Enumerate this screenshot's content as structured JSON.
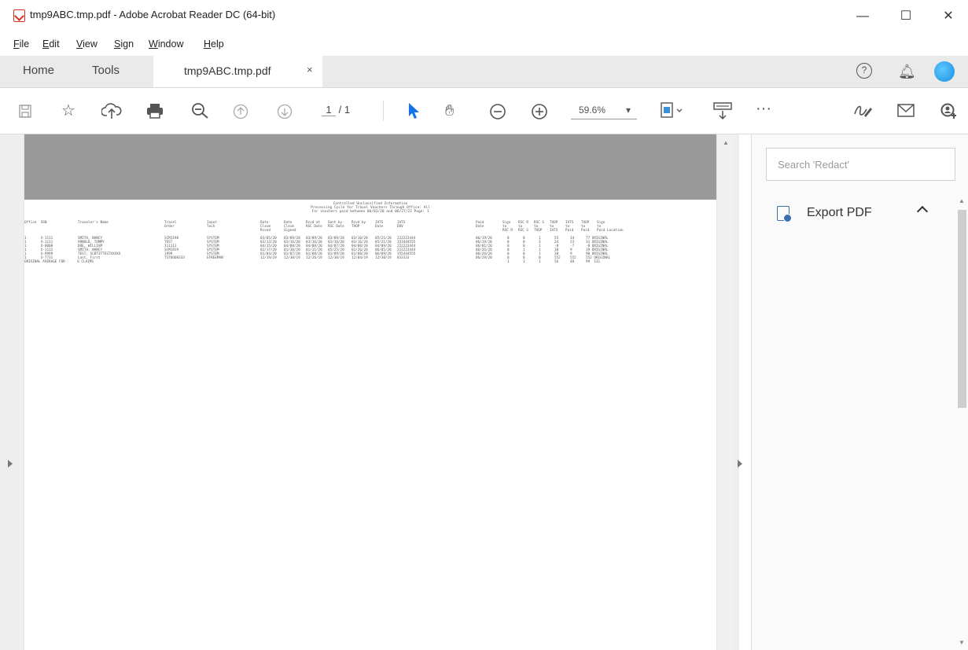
{
  "window": {
    "title": "tmp9ABC.tmp.pdf - Adobe Acrobat Reader DC (64-bit)",
    "minimize": "—",
    "maximize": "☐",
    "close": "✕"
  },
  "menu": [
    {
      "underline": "F",
      "rest": "ile"
    },
    {
      "underline": "E",
      "rest": "dit"
    },
    {
      "underline": "V",
      "rest": "iew"
    },
    {
      "underline": "S",
      "rest": "ign"
    },
    {
      "underline": "W",
      "rest": "indow"
    },
    {
      "underline": "H",
      "rest": "elp"
    }
  ],
  "tabs": {
    "home": "Home",
    "tools": "Tools",
    "document": "tmp9ABC.tmp.pdf",
    "close": "×",
    "help": "?"
  },
  "toolbar": {
    "page_current": "1",
    "page_total": "/ 1",
    "zoom": "59.6%",
    "zoom_caret": "▾",
    "more": "···"
  },
  "icons": {
    "save": "save-icon",
    "bookmark": "star-icon",
    "upload": "cloud-upload-icon",
    "print": "printer-icon",
    "search": "magnifier-icon",
    "prev": "page-up-icon",
    "next": "page-down-icon",
    "select": "cursor-icon",
    "hand": "hand-icon",
    "zoom_out": "zoom-out-icon",
    "zoom_in": "zoom-in-icon",
    "fit": "fit-page-icon",
    "stamp": "stamp-icon",
    "sign": "sign-icon",
    "mail": "mail-icon",
    "account": "account-icon"
  },
  "right_pane": {
    "search_placeholder": "Search 'Redact'",
    "export_label": "Export PDF"
  },
  "colors": {
    "accent": "#1473e6",
    "avatar": "#1a8fe0",
    "banner": "#999999"
  },
  "report": {
    "header_lines": [
      "Controlled Unclassified Information",
      "Processing Cycle for Travel Vouchers Through Office: All",
      "For vouchers paid between 06/01/20 and 06/27/22       Page:  1"
    ],
    "columns": [
      "Office  SSN",
      "Traveler's Name",
      "Travel\nOrder",
      "Input\nTech",
      "Date\nClaim\nRcved",
      "Date\nClaim\nSigned",
      "Rcvd at\nRSC Date",
      "Sent by\nRSC Date",
      "Rcvd by\nTVOP",
      "IATS\nDate",
      "IATS\nDOV",
      "Paid\nDate",
      "Sign\nto\nRSC R",
      "RSC R\nto\nRSC S",
      "RSC S\nto\nTVOP",
      "TVOP\nto\nIATS",
      "IATS\nto\nPaid",
      "TVOP\nto\nPaid",
      "Sign\nto\nPaid Location"
    ],
    "rows": [
      [
        "1       X-1111",
        "SMITH, NANCY",
        "SCM1198",
        "SYSTEM",
        "03/05/20",
        "03/09/20",
        "03/09/20",
        "03/09/20",
        "03/10/20",
        "05/21/20",
        "222223444",
        "06/19/20",
        "0",
        "0",
        "1",
        "55",
        "34",
        "77 ORIGINAL"
      ],
      [
        "1       X-1111",
        "ARNOLD, TOMMY",
        "TEST",
        "SYSTEM",
        "03/13/20",
        "03/16/20",
        "03/16/20",
        "03/16/20",
        "03/16/20",
        "05/21/20",
        "333444555",
        "06/19/20",
        "0",
        "0",
        "3",
        "24",
        "23",
        "31 ORIGINAL"
      ],
      [
        "1       X-0000",
        "DOE, WILLIAM",
        "111111",
        "SYSTEM",
        "04/15/20",
        "04/08/20",
        "04/08/20",
        "04/07/20",
        "04/08/20",
        "04/09/20",
        "222223444",
        "06/01/20",
        "0",
        "0",
        "1",
        "-8",
        "-7",
        "-8 ORIGINAL"
      ],
      [
        "1       X-1111",
        "SMITH, NANCY",
        "SCM1919",
        "SYSTEM",
        "01/17/20",
        "01/30/20",
        "01/31/20",
        "05/25/20",
        "01/26/20",
        "06/05/20",
        "222223444",
        "06/26/20",
        "0",
        "1",
        "1",
        "38",
        "9",
        "39 ORIGINAL"
      ],
      [
        "1       X-9999",
        "TEST, SCBTIFTESTXXXXX",
        "1999",
        "SYSTEM",
        "01/04/20",
        "01/07/20",
        "01/08/20",
        "01/09/20",
        "01/08/20",
        "06/09/20",
        "355444555",
        "06/26/20",
        "0",
        "0",
        "1",
        "38",
        "9",
        "90 ORIGINAL"
      ],
      [
        "1       X-7731",
        "Last, First",
        "TSTOOO8333",
        "EFREEMAN",
        "12/19/19",
        "12/30/19",
        "12/26/19",
        "12/30/19",
        "12/04/19",
        "12/30/19",
        "833333",
        "06/29/20",
        "0",
        "0",
        "0",
        "552",
        "552",
        "552 ORIGINAL"
      ],
      [
        "ORIGINAL AVERAGE FOR      6 CLAIMS",
        "",
        "",
        "",
        "",
        "",
        "",
        "",
        "",
        "",
        "",
        "",
        "1",
        "1",
        "1",
        "56",
        "48",
        "99  131"
      ]
    ]
  }
}
